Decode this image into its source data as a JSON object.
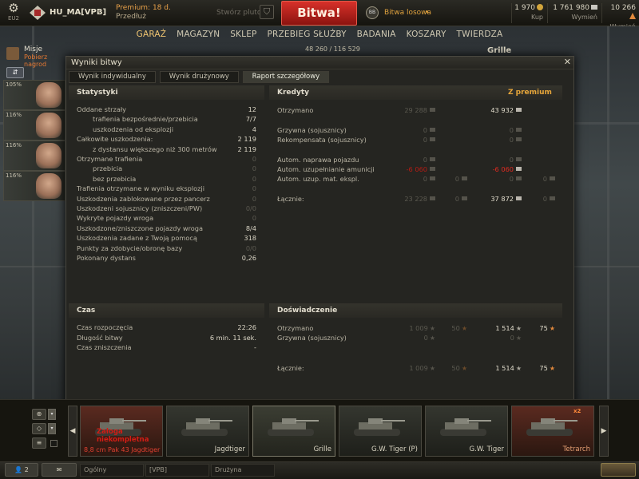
{
  "topbar": {
    "server": "EU2",
    "player_name": "HU_MA[VPB]",
    "premium_label": "Premium: 18 d.",
    "premium_sub": "Przedłuż",
    "platoon_label": "Stwórz pluton",
    "battle_label": "Bitwa!",
    "mode_icon": "BB",
    "mode_label": "Bitwa losowa",
    "gold": {
      "value": "1 970",
      "label": "Kup"
    },
    "credits": {
      "value": "1 761 980",
      "label": "Wymień"
    },
    "free_xp": {
      "value": "10 266",
      "label": "Wymień"
    }
  },
  "nav": [
    "GARAŻ",
    "MAGAZYN",
    "SKLEP",
    "PRZEBIEG SŁUŻBY",
    "BADANIA",
    "KOSZARY",
    "TWIERDZA"
  ],
  "nav_active": 0,
  "left_hud": {
    "missions_title": "Misje",
    "missions_sub": "Pobierz nagrod",
    "crew_pcts": [
      "105%",
      "116%",
      "116%",
      "116%"
    ]
  },
  "hud_stats": {
    "xp_text": "48 260 / 116 529",
    "tank_name": "Grille"
  },
  "dialog": {
    "title": "Wyniki bitwy",
    "tabs": [
      "Wynik indywidualny",
      "Wynik drużynowy",
      "Raport szczegółowy"
    ],
    "active_tab": 2,
    "stats_title": "Statystyki",
    "stats": [
      {
        "label": "Oddane strzały",
        "value": "12",
        "indent": false,
        "dim": false
      },
      {
        "label": "trafienia bezpośrednie/przebicia",
        "value": "7/7",
        "indent": true,
        "dim": false
      },
      {
        "label": "uszkodzenia od eksplozji",
        "value": "4",
        "indent": true,
        "dim": false
      },
      {
        "label": "Całkowite uszkodzenia:",
        "value": "2 119",
        "indent": false,
        "dim": false
      },
      {
        "label": "z dystansu większego niż 300 metrów",
        "value": "2 119",
        "indent": true,
        "dim": false
      },
      {
        "label": "Otrzymane trafienia",
        "value": "0",
        "indent": false,
        "dim": true
      },
      {
        "label": "przebicia",
        "value": "0",
        "indent": true,
        "dim": true
      },
      {
        "label": "bez przebicia",
        "value": "0",
        "indent": true,
        "dim": true
      },
      {
        "label": "Trafienia otrzymane w wyniku eksplozji",
        "value": "0",
        "indent": false,
        "dim": true
      },
      {
        "label": "Uszkodzenia zablokowane przez pancerz",
        "value": "0",
        "indent": false,
        "dim": true
      },
      {
        "label": "Uszkodzeni sojusznicy (zniszczeni/PW)",
        "value": "0/0",
        "indent": false,
        "dim": true
      },
      {
        "label": "Wykryte pojazdy wroga",
        "value": "0",
        "indent": false,
        "dim": true
      },
      {
        "label": "Uszkodzone/zniszczone pojazdy wroga",
        "value": "8/4",
        "indent": false,
        "dim": false
      },
      {
        "label": "Uszkodzenia zadane z Twoją pomocą",
        "value": "318",
        "indent": false,
        "dim": false
      },
      {
        "label": "Punkty za zdobycie/obronę bazy",
        "value": "0/0",
        "indent": false,
        "dim": true
      },
      {
        "label": "Pokonany dystans",
        "value": "0,26",
        "indent": false,
        "dim": false
      }
    ],
    "credits_title": "Kredyty",
    "premium_col": "Z premium",
    "credits": [
      {
        "label": "Otrzymano",
        "base": "29 288",
        "base2": "",
        "prem": "43 932",
        "prem2": ""
      },
      {
        "label": "Grzywna (sojusznicy)",
        "base": "0",
        "base2": "",
        "prem": "0",
        "prem2": ""
      },
      {
        "label": "Rekompensata (sojusznicy)",
        "base": "0",
        "base2": "",
        "prem": "0",
        "prem2": ""
      },
      {
        "label": "Autom. naprawa pojazdu",
        "base": "0",
        "base2": "",
        "prem": "0",
        "prem2": ""
      },
      {
        "label": "Autom. uzupełnianie amunicji",
        "base": "-6 060",
        "base2": "",
        "prem": "-6 060",
        "prem2": ""
      },
      {
        "label": "Autom. uzup. mat. ekspl.",
        "base": "0",
        "base2": "0",
        "prem": "0",
        "prem2": "0"
      },
      {
        "label": "Łącznie:",
        "base": "23 228",
        "base2": "0",
        "prem": "37 872",
        "prem2": "0"
      }
    ],
    "time_title": "Czas",
    "time": [
      {
        "label": "Czas rozpoczęcia",
        "value": "22:26"
      },
      {
        "label": "Długość bitwy",
        "value": "6 min. 11 sek."
      },
      {
        "label": "Czas zniszczenia",
        "value": "-"
      }
    ],
    "xp_title": "Doświadczenie",
    "xp": [
      {
        "label": "Otrzymano",
        "base": "1 009",
        "base_free": "50",
        "prem": "1 514",
        "prem_free": "75"
      },
      {
        "label": "Grzywna (sojusznicy)",
        "base": "0",
        "base_free": "",
        "prem": "0",
        "prem_free": ""
      },
      {
        "label": "Łącznie:",
        "base": "1 009",
        "base_free": "50",
        "prem": "1 514",
        "prem_free": "75"
      }
    ]
  },
  "carousel": {
    "slots": [
      {
        "name": "8,8 cm Pak 43 Jagdtiger",
        "warning": "Załoga niekompletna",
        "style": "red"
      },
      {
        "name": "Jagdtiger",
        "warning": "",
        "style": "normal"
      },
      {
        "name": "Grille",
        "warning": "",
        "style": "sel"
      },
      {
        "name": "G.W. Tiger (P)",
        "warning": "",
        "style": "normal"
      },
      {
        "name": "G.W. Tiger",
        "warning": "",
        "style": "normal"
      },
      {
        "name": "Tetrarch",
        "warning": "",
        "style": "red"
      }
    ],
    "x2_label": "x2"
  },
  "bottombar": {
    "friends_count": "2",
    "channels": [
      "Ogólny",
      "[VPB]",
      "Drużyna"
    ]
  }
}
